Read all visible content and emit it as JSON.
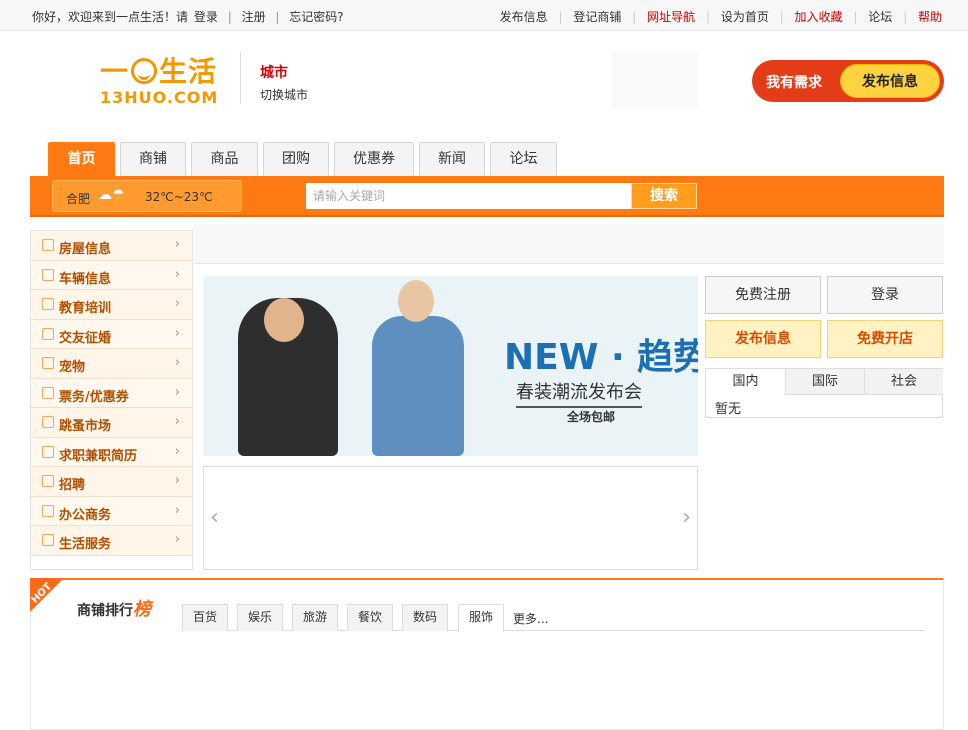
{
  "topbar": {
    "greeting": "你好，欢迎来到一点生活！请",
    "login": "登录",
    "register": "注册",
    "forgot": "忘记密码?",
    "links": [
      "发布信息",
      "登记商铺",
      "网址导航",
      "设为首页",
      "加入收藏",
      "论坛",
      "帮助"
    ]
  },
  "header": {
    "logo_cn": "一点生活",
    "logo_en": "13HUO.COM",
    "city": "城市",
    "switch_city": "切换城市",
    "need_label": "我有需求",
    "post_label": "发布信息"
  },
  "nav": {
    "tabs": [
      "首页",
      "商铺",
      "商品",
      "团购",
      "优惠券",
      "新闻",
      "论坛"
    ],
    "active": 0
  },
  "bar": {
    "weather_city": "合肥",
    "weather_temp": "32℃~23℃",
    "search_placeholder": "请输入关键词",
    "search_button": "搜索"
  },
  "categories": [
    "房屋信息",
    "车辆信息",
    "教育培训",
    "交友征婚",
    "宠物",
    "票务/优惠券",
    "跳蚤市场",
    "求职兼职简历",
    "招聘",
    "办公商务",
    "生活服务"
  ],
  "banner": {
    "headline": "NEW · 趋势",
    "subline": "春装潮流发布会",
    "note": "全场包邮"
  },
  "right_buttons": {
    "free_register": "免费注册",
    "login": "登录",
    "post_info": "发布信息",
    "open_shop": "免费开店"
  },
  "news": {
    "tabs": [
      "国内",
      "国际",
      "社会"
    ],
    "empty": "暂无"
  },
  "ranking": {
    "hot": "HOT",
    "title": "商铺排行",
    "title_em": "榜",
    "tabs": [
      "百货",
      "娱乐",
      "旅游",
      "餐饮",
      "数码",
      "服饰"
    ],
    "active": 5,
    "more": "更多..."
  },
  "colors": {
    "accent": "#ff7a12",
    "brand": "#f39800",
    "red": "#d40000"
  }
}
